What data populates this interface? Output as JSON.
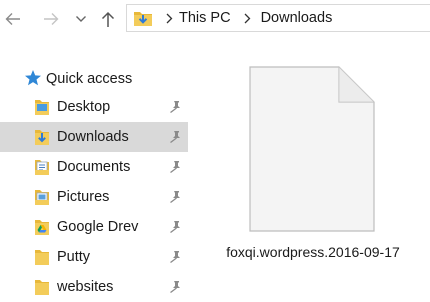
{
  "toolbar": {
    "back_icon": "arrow-left-icon",
    "forward_icon": "arrow-right-icon",
    "recent_icon": "chevron-down-icon",
    "up_icon": "arrow-up-icon"
  },
  "address": {
    "location_icon": "downloads-folder-icon",
    "crumbs": [
      "This PC",
      "Downloads"
    ]
  },
  "sidebar": {
    "quick_access": {
      "label": "Quick access",
      "icon": "star-icon"
    },
    "items": [
      {
        "label": "Desktop",
        "icon": "folder-icon",
        "pinned": true
      },
      {
        "label": "Downloads",
        "icon": "downloads-folder-icon",
        "pinned": true,
        "selected": true
      },
      {
        "label": "Documents",
        "icon": "documents-folder-icon",
        "pinned": true
      },
      {
        "label": "Pictures",
        "icon": "pictures-folder-icon",
        "pinned": true
      },
      {
        "label": "Google Drev",
        "icon": "google-drive-folder-icon",
        "pinned": true
      },
      {
        "label": "Putty",
        "icon": "folder-icon",
        "pinned": true
      },
      {
        "label": "websites",
        "icon": "folder-icon",
        "pinned": true
      }
    ]
  },
  "content": {
    "files": [
      {
        "name": "foxqi.wordpress.2016-09-17",
        "icon": "blank-file-icon"
      }
    ]
  },
  "colors": {
    "selection": "#d9d9d9",
    "folder_yellow": "#e8b83a",
    "star_blue": "#2f87d6",
    "arrow_blue": "#2f7bd8"
  }
}
